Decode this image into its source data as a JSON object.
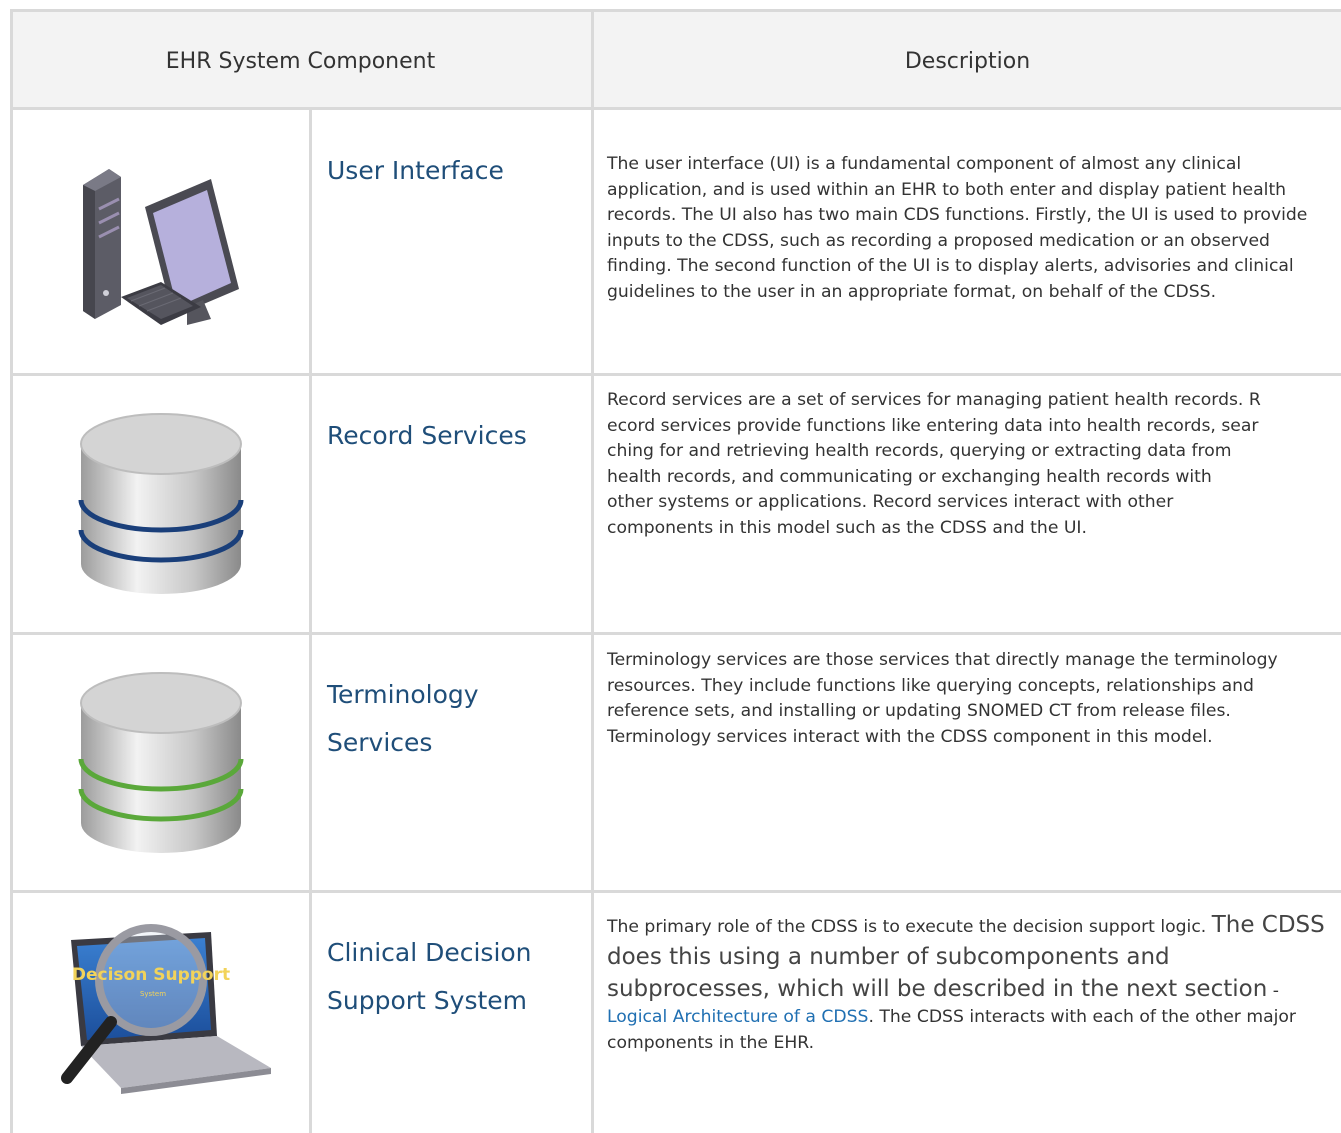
{
  "header": {
    "component": "EHR System Component",
    "description": "Description"
  },
  "rows": [
    {
      "icon": "computer-icon",
      "name_line1": "User Interface",
      "name_line2": "",
      "description": "The user interface (UI) is a fundamental component of almost any clinical application, and is used within an EHR to both enter and display patient health records. The UI also has two main CDS functions. Firstly, the UI is used to provide inputs to the CDSS, such as recording a proposed medication or an observed finding. The second function of the UI is to display alerts, advisories and clinical guidelines to the user in an appropriate format, on behalf of the CDSS."
    },
    {
      "icon": "database-icon",
      "icon_stripe_color": "#1a3f7a",
      "name_line1": "Record Services",
      "name_line2": "",
      "description_lines": [
        "Record services are a set of services for managing patient health records. R",
        "ecord services provide functions like entering data into health records, sear",
        "ching for and retrieving health records, querying or extracting data from",
        "health records, and communicating or exchanging health records with",
        "other systems or applications. Record services interact with other",
        "components in this model such as the CDSS and the UI."
      ]
    },
    {
      "icon": "database-icon",
      "icon_stripe_color": "#5aa83a",
      "name_line1": "Terminology",
      "name_line2": "Services",
      "description": "Terminology services are those services that directly manage the terminology resources. They include functions like querying concepts, relationships and reference sets, and installing or updating SNOMED CT from release files. Terminology services interact with the CDSS component in this model."
    },
    {
      "icon": "magnifier-laptop-icon",
      "icon_text": "Decison Support",
      "icon_subtext": "System",
      "name_line1": "Clinical Decision",
      "name_line2": "Support System",
      "description_part1": "The primary role of the CDSS is to execute the decision support logic. ",
      "description_big": "The CDSS does this using a number of subcomponents and subprocesses, which will be described in the next section",
      "description_dash": " - ",
      "description_link": "Logical Architecture of a CDSS",
      "description_part2": ". The CDSS interacts with each of the other major components in the EHR."
    }
  ]
}
